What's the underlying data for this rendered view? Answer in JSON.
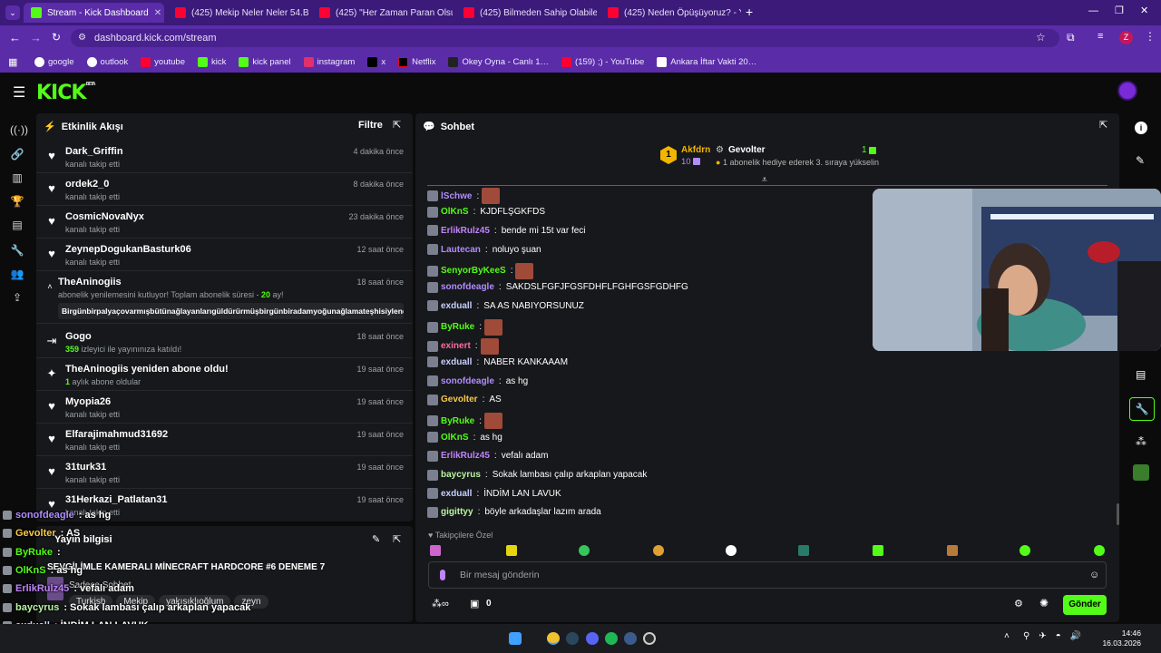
{
  "browser": {
    "tabs": [
      {
        "title": "Stream - Kick Dashboard",
        "icon": "kick-icon"
      },
      {
        "title": "(425) Mekip Neler Neler 54.Böl…",
        "icon": "youtube-icon"
      },
      {
        "title": "(425) \"Her Zaman Paran Olsun…",
        "icon": "youtube-icon"
      },
      {
        "title": "(425) Bilmeden Sahip Olabilece…",
        "icon": "youtube-icon"
      },
      {
        "title": "(425) Neden Öpüşüyoruz? - You…",
        "icon": "youtube-icon"
      }
    ],
    "url": "dashboard.kick.com/stream",
    "bookmarks": [
      "google",
      "outlook",
      "youtube",
      "kick",
      "kick panel",
      "instagram",
      "x",
      "Netflix",
      "Okey Oyna - Canlı 1…",
      "(159) ;) - YouTube",
      "Ankara İftar Vakti 20…"
    ],
    "profile_letter": "Z"
  },
  "kick": {
    "logo": "KICK",
    "logo_badge": "BETA"
  },
  "events": {
    "title": "Etkinlik Akışı",
    "filter": "Filtre",
    "items": [
      {
        "name": "Dark_Griffin",
        "sub": "kanalı takip etti",
        "time": "4 dakika önce",
        "icon": "heart-icon"
      },
      {
        "name": "ordek2_0",
        "sub": "kanalı takip etti",
        "time": "8 dakika önce",
        "icon": "heart-icon"
      },
      {
        "name": "CosmicNovaNyx",
        "sub": "kanalı takip etti",
        "time": "23 dakika önce",
        "icon": "heart-icon"
      },
      {
        "name": "ZeynepDogukanBasturk06",
        "sub": "kanalı takip etti",
        "time": "12 saat önce",
        "icon": "heart-icon"
      }
    ],
    "resub": {
      "name": "TheAninogiis",
      "time": "18 saat önce",
      "text_pre": "abonelik yenilemesini kutluyor! Toplam abonelik süresi - ",
      "months": "20",
      "text_post": " ay!",
      "message": "Birgünbirpalyaçovarmışbütünağlayanlarıgüldürürmüşbirgünbiradamyoğunağlamateşhisiylendoktor"
    },
    "raid": {
      "name": "Gogo",
      "count": "359",
      "sub": " izleyici ile yayınınıza katıldı!",
      "time": "18 saat önce"
    },
    "newsub": {
      "name": "TheAninogiis yeniden abone oldu!",
      "count": "1",
      "sub": " aylık abone oldular",
      "time": "19 saat önce"
    },
    "items2": [
      {
        "name": "Myopia26",
        "sub": "kanalı takip etti",
        "time": "19 saat önce"
      },
      {
        "name": "Elfarajimahmud31692",
        "sub": "kanalı takip etti",
        "time": "19 saat önce"
      },
      {
        "name": "31turk31",
        "sub": "kanalı takip etti",
        "time": "19 saat önce"
      },
      {
        "name": "31Herkazi_Patlatan31",
        "sub": "kanalı takip etti",
        "time": "19 saat önce"
      }
    ]
  },
  "info": {
    "title": "Yayın bilgisi",
    "stream_title": "SEVGİLİMLE KAMERALI MİNECRAFT HARDCORE #6 DENEME 7",
    "category": "Sadece Sohbet",
    "tags": [
      "Turkish",
      "Mekip",
      "yakışıklıoğlum",
      "zeyn"
    ]
  },
  "chat": {
    "title": "Sohbet",
    "top_gifter": {
      "rank": "1",
      "name": "Akfdrn",
      "count": "10"
    },
    "gifter2": {
      "name": "Gevolter",
      "count": "1",
      "note": "1 abonelik hediye ederek 3. sıraya yükselin"
    },
    "messages": [
      {
        "user": "lSchwe",
        "color": "#b08cff",
        "text": "",
        "emote": true
      },
      {
        "user": "OlKnS",
        "color": "#53fc18",
        "text": "KJDFLŞGKFDS"
      },
      {
        "user": "ErlikRulz45",
        "color": "#c084fc",
        "text": "bende mi 15t var feci"
      },
      {
        "user": "Lautecan",
        "color": "#b08cff",
        "text": "noluyo şuan"
      },
      {
        "user": "SenyorByKeeS",
        "color": "#53fc18",
        "text": "",
        "emote": true
      },
      {
        "user": "sonofdeagle",
        "color": "#b08cff",
        "text": "SAKDSLFGFJFGSFDHFLFGHFGSFGDHFG"
      },
      {
        "user": "exduall",
        "color": "#c8d0ff",
        "text": "SA AS NABIYORSUNUZ"
      },
      {
        "user": "ByRuke",
        "color": "#53fc18",
        "text": "",
        "emote": true
      },
      {
        "user": "exinert",
        "color": "#ff6b9d",
        "text": "",
        "emote": true
      },
      {
        "user": "exduall",
        "color": "#c8d0ff",
        "text": "NABER KANKAAAM"
      },
      {
        "user": "sonofdeagle",
        "color": "#b08cff",
        "text": "as hg"
      },
      {
        "user": "Gevolter",
        "color": "#f7c948",
        "text": "AS"
      },
      {
        "user": "ByRuke",
        "color": "#53fc18",
        "text": "",
        "emote": true
      },
      {
        "user": "OlKnS",
        "color": "#53fc18",
        "text": "as hg"
      },
      {
        "user": "ErlikRulz45",
        "color": "#c084fc",
        "text": "vefalı adam"
      },
      {
        "user": "baycyrus",
        "color": "#b9f5a0",
        "text": "Sokak lambası çalıp arkaplan yapacak"
      },
      {
        "user": "exduall",
        "color": "#c8d0ff",
        "text": "İNDİM LAN LAVUK"
      },
      {
        "user": "gigittyy",
        "color": "#b9f5a0",
        "text": "böyle arkadaşlar lazım arada"
      }
    ],
    "followers_only": "Takipçilere Özel",
    "placeholder": "Bir mesaj gönderin",
    "send": "Gönder",
    "count": "0"
  },
  "overlay": [
    {
      "user": "sonofdeagle",
      "text": ": as hg",
      "color": "#b08cff"
    },
    {
      "user": "Gevolter",
      "text": ": AS",
      "color": "#f7c948"
    },
    {
      "user": "ByRuke",
      "text": ":",
      "color": "#53fc18"
    },
    {
      "user": "OlKnS",
      "text": ": as hg",
      "color": "#53fc18"
    },
    {
      "user": "ErlikRulz45",
      "text": ": vefalı adam",
      "color": "#c084fc"
    },
    {
      "user": "baycyrus",
      "text": ": Sokak lambası çalıp arkaplan yapacak",
      "color": "#b9f5a0"
    },
    {
      "user": "exduall",
      "text": ": İNDİM LAN LAVUK",
      "color": "#c8d0ff"
    },
    {
      "user": "gigittyy",
      "text": ": böyle arkadaşlar lazım arada",
      "color": "#b9f5a0"
    }
  ],
  "taskbar": {
    "time": "14:46",
    "date": "16.03.2026"
  }
}
